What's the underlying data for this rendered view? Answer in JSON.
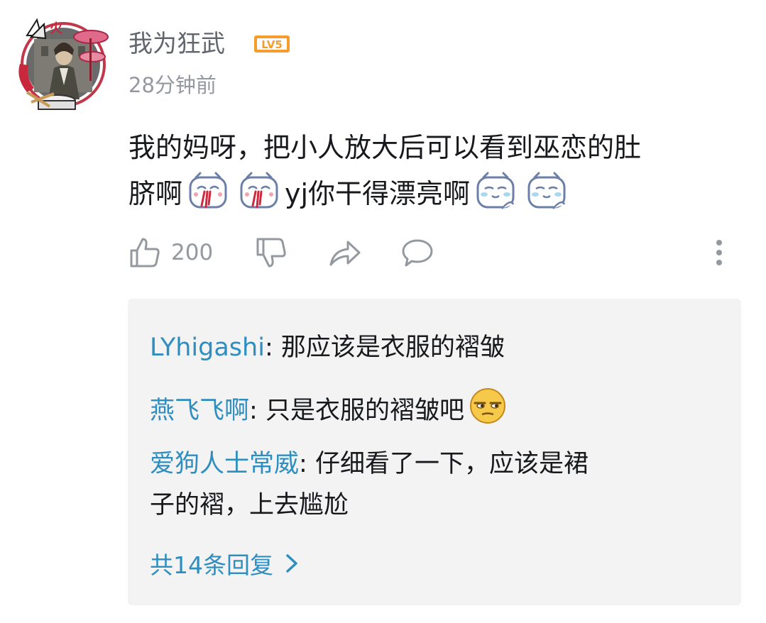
{
  "comment": {
    "username": "我为狂武",
    "level": "LV5",
    "timestamp": "28分钟前",
    "text_line1": "我的妈呀，把小人放大后可以看到巫恋的肚",
    "text_line2_a": "脐啊",
    "text_line2_b": "yj你干得漂亮啊",
    "emotes": [
      "nosebleed-emote",
      "nosebleed-emote",
      "shy-emote",
      "shy-emote"
    ]
  },
  "actions": {
    "like_count": "200",
    "icons": [
      "thumbs-up-icon",
      "thumbs-down-icon",
      "share-icon",
      "comment-icon",
      "more-icon"
    ]
  },
  "replies": [
    {
      "user": "LYhigashi",
      "text": "那应该是衣服的褶皱"
    },
    {
      "user": "燕飞飞啊",
      "text": "只是衣服的褶皱吧"
    },
    {
      "user": "爱狗人士常威",
      "text": "仔细看了一下，应该是裙",
      "text_cont": "子的褶，上去尴尬"
    }
  ],
  "separator": ": ",
  "more_replies_label": "共14条回复",
  "colors": {
    "link_blue": "#2f8ec0",
    "level_orange": "#f49c2c",
    "muted_gray": "#9499a0",
    "reply_bg": "#f3f3f3"
  }
}
